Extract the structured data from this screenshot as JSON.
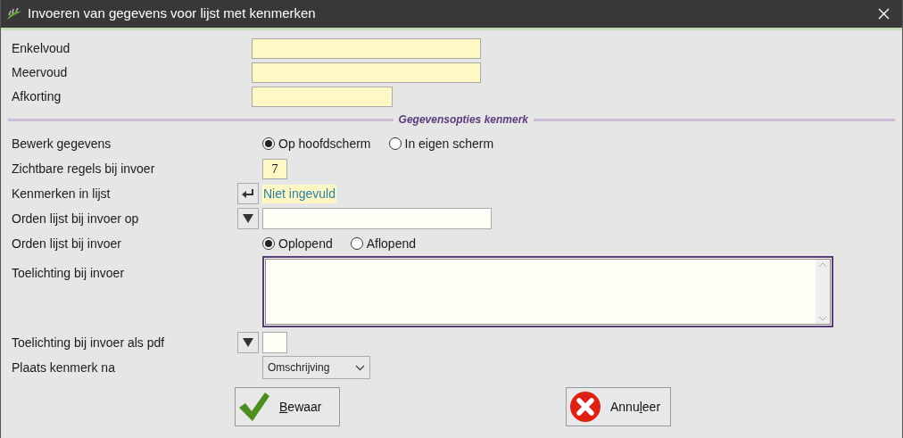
{
  "window": {
    "title": "Invoeren van gegevens voor lijst met kenmerken"
  },
  "top_fields": [
    {
      "label": "Enkelvoud"
    },
    {
      "label": "Meervoud"
    },
    {
      "label": "Afkorting"
    }
  ],
  "section": {
    "title": "Gegevensopties kenmerk"
  },
  "rows": [
    {
      "kind": "radio",
      "label": "Bewerk gegevens",
      "options": [
        {
          "label": "Op hoofdscherm",
          "selected": true
        },
        {
          "label": "In eigen scherm",
          "selected": false
        }
      ]
    },
    {
      "kind": "number",
      "label": "Zichtbare regels bij invoer",
      "value": "7"
    },
    {
      "kind": "link",
      "label": "Kenmerken in lijst",
      "value": "Niet ingevuld"
    },
    {
      "kind": "picker",
      "label": "Orden lijst bij invoer op"
    },
    {
      "kind": "radio",
      "label": "Orden lijst bij invoer",
      "options": [
        {
          "label": "Oplopend",
          "selected": true
        },
        {
          "label": "Aflopend",
          "selected": false
        }
      ]
    },
    {
      "kind": "textarea",
      "label": "Toelichting bij invoer"
    },
    {
      "kind": "small-picker",
      "label": "Toelichting bij invoer als pdf"
    },
    {
      "kind": "select",
      "label": "Plaats kenmerk na",
      "value": "Omschrijving"
    }
  ],
  "buttons": [
    {
      "kind": "save",
      "key": "B",
      "after": "ewaar"
    },
    {
      "kind": "cancel",
      "before": "Annu",
      "key": "l",
      "after": "eer"
    }
  ]
}
